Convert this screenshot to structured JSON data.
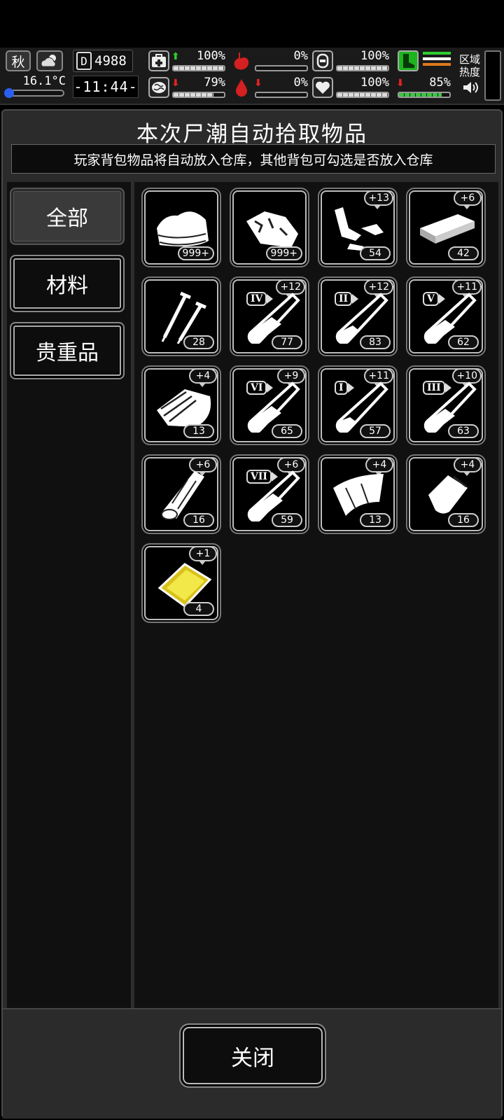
{
  "hud": {
    "season": "秋",
    "temperature": "16.1°C",
    "days": "4988",
    "day_icon": "D",
    "clock": "-11:44-",
    "health": {
      "percent": "100%",
      "trend": "up",
      "level": 1.0
    },
    "hunger": {
      "percent": "0%",
      "trend": "none",
      "level": 0.0
    },
    "armor": {
      "percent": "100%",
      "trend": "none",
      "level": 1.0
    },
    "mood": {
      "percent": "79%",
      "trend": "down",
      "level": 0.79
    },
    "blood": {
      "percent": "0%",
      "trend": "down",
      "level": 0.0
    },
    "heart": {
      "percent": "100%",
      "trend": "none",
      "level": 1.0
    },
    "stamina": {
      "percent": "85%",
      "trend": "down",
      "level": 0.85
    },
    "region_label_line1": "区域",
    "region_label_line2": "热度",
    "colors": {
      "up": "#2dcf2d",
      "down": "#e52222",
      "stamina": "#3ec43e",
      "weapon": "#1db51d"
    }
  },
  "panel": {
    "title": "本次尸潮自动拾取物品",
    "subtitle": "玩家背包物品将自动放入仓库，其他背包可勾选是否放入仓库"
  },
  "tabs": [
    {
      "label": "全部",
      "active": true
    },
    {
      "label": "材料",
      "active": false
    },
    {
      "label": "贵重品",
      "active": false
    }
  ],
  "items": [
    {
      "name": "cloth",
      "count": "999+",
      "bonus": ""
    },
    {
      "name": "meat",
      "count": "999+",
      "bonus": ""
    },
    {
      "name": "scrap-parts",
      "count": "54",
      "bonus": "+13"
    },
    {
      "name": "board",
      "count": "42",
      "bonus": "+6"
    },
    {
      "name": "nails",
      "count": "28",
      "bonus": ""
    },
    {
      "name": "serum-iv",
      "count": "77",
      "bonus": "+12",
      "grade": "IV"
    },
    {
      "name": "serum-ii",
      "count": "83",
      "bonus": "+12",
      "grade": "II"
    },
    {
      "name": "serum-v",
      "count": "62",
      "bonus": "+11",
      "grade": "V"
    },
    {
      "name": "wood-pile",
      "count": "13",
      "bonus": "+4"
    },
    {
      "name": "serum-vi",
      "count": "65",
      "bonus": "+9",
      "grade": "VI"
    },
    {
      "name": "serum-i",
      "count": "57",
      "bonus": "+11",
      "grade": "I"
    },
    {
      "name": "serum-iii",
      "count": "63",
      "bonus": "+10",
      "grade": "III"
    },
    {
      "name": "log",
      "count": "16",
      "bonus": "+6"
    },
    {
      "name": "serum-vii",
      "count": "59",
      "bonus": "+6",
      "grade": "VII"
    },
    {
      "name": "leather",
      "count": "13",
      "bonus": "+4"
    },
    {
      "name": "bag",
      "count": "16",
      "bonus": "+4"
    },
    {
      "name": "gold-card",
      "count": "4",
      "bonus": "+1"
    }
  ],
  "footer": {
    "close_label": "关闭"
  }
}
